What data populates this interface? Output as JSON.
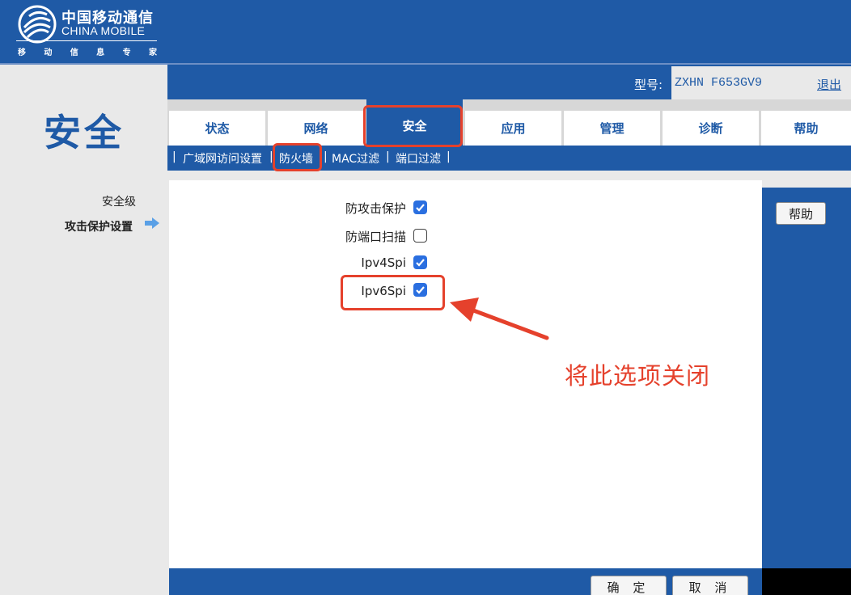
{
  "brand": {
    "name_cn": "中国移动通信",
    "name_en": "CHINA MOBILE",
    "slogan": [
      "移",
      "动",
      "信",
      "息",
      "专",
      "家"
    ]
  },
  "model": {
    "label": "型号:",
    "value": "ZXHN F653GV9",
    "logout": "退出"
  },
  "section_title": "安全",
  "tabs": [
    {
      "label": "状态",
      "active": false
    },
    {
      "label": "网络",
      "active": false
    },
    {
      "label": "安全",
      "active": true
    },
    {
      "label": "应用",
      "active": false
    },
    {
      "label": "管理",
      "active": false
    },
    {
      "label": "诊断",
      "active": false
    },
    {
      "label": "帮助",
      "active": false
    }
  ],
  "subnav": {
    "items": [
      "广域网访问设置",
      "防火墙",
      "MAC过滤",
      "端口过滤"
    ],
    "active": "防火墙",
    "separator": "|"
  },
  "left_menu": {
    "items": [
      {
        "label": "安全级",
        "active": false
      },
      {
        "label": "攻击保护设置",
        "active": true
      }
    ]
  },
  "options": [
    {
      "label": "防攻击保护",
      "checked": true
    },
    {
      "label": "防端口扫描",
      "checked": false
    },
    {
      "label": "Ipv4Spi",
      "checked": true
    },
    {
      "label": "Ipv6Spi",
      "checked": true
    }
  ],
  "help_button": "帮助",
  "annotation": "将此选项关闭",
  "buttons": {
    "confirm": "确 定",
    "cancel": "取 消"
  },
  "colors": {
    "brand_blue": "#1f5aa6",
    "annotation_red": "#e5412c",
    "checkbox_blue": "#2a6fe0"
  }
}
